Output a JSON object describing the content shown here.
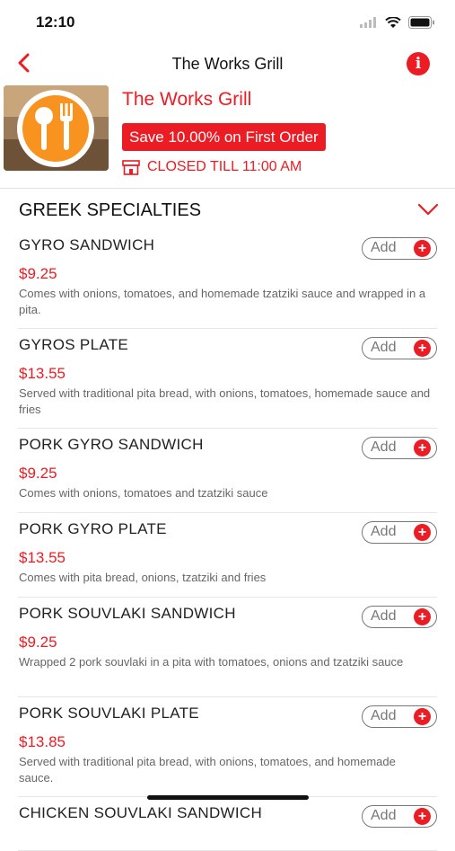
{
  "status_bar": {
    "time": "12:10"
  },
  "nav": {
    "title": "The Works Grill"
  },
  "restaurant": {
    "name": "The Works Grill",
    "promo": "Save 10.00% on First Order",
    "status": "CLOSED TILL 11:00 AM"
  },
  "section": {
    "title": "GREEK SPECIALTIES"
  },
  "add_label": "Add",
  "add_plus": "+",
  "colors": {
    "accent": "#ec1c24",
    "text": "#222222",
    "muted": "#666666"
  },
  "menu_items": [
    {
      "name": "GYRO SANDWICH",
      "price": "$9.25",
      "description": "Comes with onions, tomatoes, and homemade tzatziki sauce and wrapped in a pita."
    },
    {
      "name": "GYROS PLATE",
      "price": "$13.55",
      "description": "Served with traditional pita bread, with onions, tomatoes, homemade sauce and fries"
    },
    {
      "name": "PORK GYRO SANDWICH",
      "price": "$9.25",
      "description": "Comes with onions, tomatoes and tzatziki sauce"
    },
    {
      "name": "PORK GYRO PLATE",
      "price": "$13.55",
      "description": "Comes with pita bread, onions, tzatziki and fries"
    },
    {
      "name": "PORK SOUVLAKI SANDWICH",
      "price": "$9.25",
      "description": "Wrapped 2 pork souvlaki in a pita with tomatoes, onions and tzatziki sauce"
    },
    {
      "name": "PORK SOUVLAKI PLATE",
      "price": "$13.85",
      "description": "Served with traditional pita bread, with onions, tomatoes, and homemade sauce."
    },
    {
      "name": "CHICKEN SOUVLAKI SANDWICH",
      "price": "",
      "description": ""
    }
  ]
}
